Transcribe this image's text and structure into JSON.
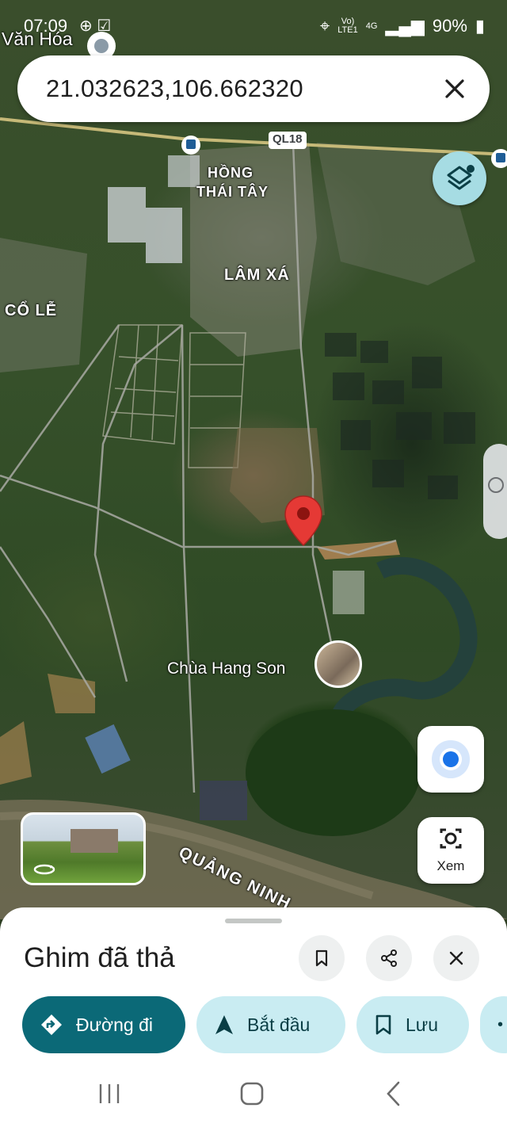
{
  "status_bar": {
    "time": "07:09",
    "network_top": "Vo)",
    "network_bottom": "LTE1",
    "network_type": "4G",
    "battery": "90%"
  },
  "search": {
    "query": "21.032623,106.662320"
  },
  "map": {
    "labels": {
      "van_hoa": "Văn Hóa",
      "hong": "HỒNG",
      "thai_tay": "THÁI TÂY",
      "lam_xa": "LÂM XÁ",
      "co_le": "CỔ LỄ",
      "ql18": "QL18",
      "chua_hang_son": "Chùa Hang Son",
      "quang_ninh": "QUẢNG NINH"
    },
    "view_button_label": "Xem"
  },
  "sheet": {
    "title": "Ghim đã thả",
    "actions": [
      {
        "label": "Đường đi",
        "icon": "directions-icon"
      },
      {
        "label": "Bắt đầu",
        "icon": "navigation-arrow-icon"
      },
      {
        "label": "Lưu",
        "icon": "bookmark-icon"
      }
    ]
  },
  "colors": {
    "accent_dark": "#0b6977",
    "accent_light": "#c9ecf2",
    "pin": "#e53935",
    "location_dot": "#1a73e8"
  }
}
